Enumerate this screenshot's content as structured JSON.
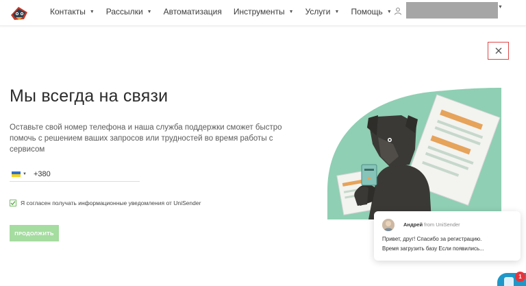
{
  "nav": {
    "items": [
      {
        "label": "Контакты",
        "has_menu": true
      },
      {
        "label": "Рассылки",
        "has_menu": true
      },
      {
        "label": "Автоматизация",
        "has_menu": false
      },
      {
        "label": "Инструменты",
        "has_menu": true
      },
      {
        "label": "Услуги",
        "has_menu": true
      },
      {
        "label": "Помощь",
        "has_menu": true
      }
    ],
    "caret": "▼"
  },
  "close": {
    "symbol": "✕"
  },
  "support": {
    "title": "Мы всегда на связи",
    "description": "Оставьте свой номер телефона и наша служба поддержки сможет быстро помочь с решением ваших запросов или трудностей во время работы с сервисом",
    "phone": {
      "value": "+380",
      "country": "Ukraine"
    },
    "consent": {
      "label": "Я согласен получать информационные уведомления от UniSender",
      "checked": true
    },
    "submit_label": "ПРОДОЛЖИТЬ"
  },
  "chat": {
    "name": "Андрей",
    "from": " from UniSender",
    "line1": "Привет, друг! Спасибо за регистрацию.",
    "line2": "Время загрузить базу Если появились...",
    "badge": "1"
  },
  "colors": {
    "accent_green": "#a5dca0",
    "close_border": "#e04646",
    "illustration_bg": "#8fcfb3",
    "chat_blue": "#1f97c8",
    "badge_red": "#e8333a"
  }
}
